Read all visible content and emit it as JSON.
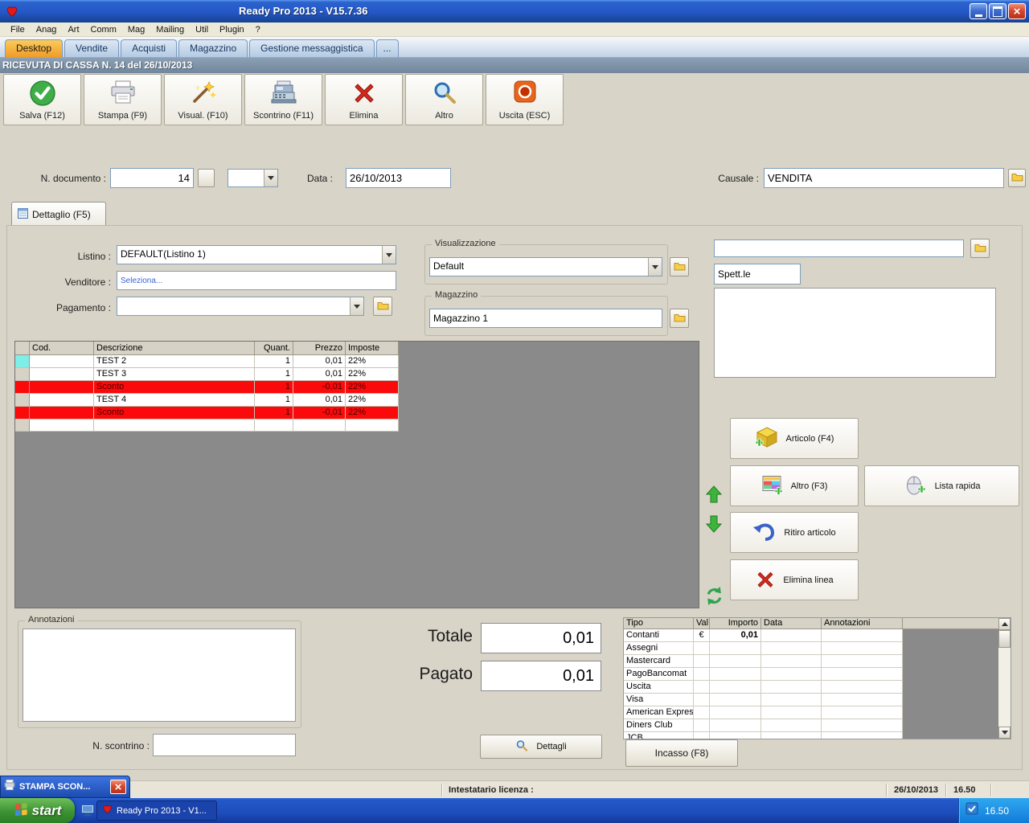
{
  "window": {
    "title": "Ready Pro 2013 - V15.7.36",
    "header_title": "RICEVUTA DI CASSA N. 14 del 26/10/2013"
  },
  "menu": {
    "items": [
      "File",
      "Anag",
      "Art",
      "Comm",
      "Mag",
      "Mailing",
      "Util",
      "Plugin",
      "?"
    ]
  },
  "tabs": {
    "items": [
      "Desktop",
      "Vendite",
      "Acquisti",
      "Magazzino",
      "Gestione messaggistica",
      "..."
    ],
    "active": "Desktop"
  },
  "toolbar": {
    "salva": "Salva (F12)",
    "stampa": "Stampa (F9)",
    "visual": "Visual. (F10)",
    "scontrino": "Scontrino (F11)",
    "elimina": "Elimina",
    "altro": "Altro",
    "uscita": "Uscita (ESC)"
  },
  "doc_fields": {
    "n_documento_label": "N. documento :",
    "n_documento": "14",
    "data_label": "Data :",
    "data": "26/10/2013",
    "causale_label": "Causale :",
    "causale": "VENDITA"
  },
  "detail_tab_label": "Dettaglio (F5)",
  "form": {
    "listino_label": "Listino :",
    "listino": "DEFAULT(Listino 1)",
    "venditore_label": "Venditore :",
    "venditore": "Seleziona...",
    "pagamento_label": "Pagamento :",
    "visualizzazione_title": "Visualizzazione",
    "visualizzazione": "Default",
    "magazzino_title": "Magazzino",
    "magazzino": "Magazzino 1",
    "spett": "Spett.le"
  },
  "items_table": {
    "headers": {
      "cod": "Cod.",
      "descrizione": "Descrizione",
      "quant": "Quant.",
      "prezzo": "Prezzo",
      "imposte": "Imposte"
    },
    "rows": [
      {
        "descrizione": "TEST 2",
        "quant": "1",
        "prezzo": "0,01",
        "imposte": "22%"
      },
      {
        "descrizione": "TEST 3",
        "quant": "1",
        "prezzo": "0,01",
        "imposte": "22%"
      },
      {
        "descrizione": "Sconto",
        "quant": "1",
        "prezzo": "-0,01",
        "imposte": "22%"
      },
      {
        "descrizione": "TEST 4",
        "quant": "1",
        "prezzo": "0,01",
        "imposte": "22%"
      },
      {
        "descrizione": "Sconto",
        "quant": "1",
        "prezzo": "-0,01",
        "imposte": "22%"
      }
    ]
  },
  "side_buttons": {
    "articolo": "Articolo (F4)",
    "altro": "Altro (F3)",
    "lista_rapida": "Lista rapida",
    "ritiro": "Ritiro articolo",
    "elimina_linea": "Elimina linea"
  },
  "bottom": {
    "annotazioni_title": "Annotazioni",
    "n_scontrino_label": "N. scontrino :",
    "totale_label": "Totale",
    "totale": "0,01",
    "pagato_label": "Pagato",
    "pagato": "0,01",
    "dettagli": "Dettagli",
    "incasso": "Incasso (F8)"
  },
  "payments": {
    "headers": {
      "tipo": "Tipo",
      "val": "Val",
      "importo": "Importo",
      "data": "Data",
      "annotazioni": "Annotazioni"
    },
    "rows": [
      {
        "tipo": "Contanti",
        "val": "€",
        "importo": "0,01"
      },
      {
        "tipo": "Assegni"
      },
      {
        "tipo": "Mastercard"
      },
      {
        "tipo": "PagoBancomat"
      },
      {
        "tipo": "Uscita"
      },
      {
        "tipo": "Visa"
      },
      {
        "tipo": "American Express"
      },
      {
        "tipo": "Diners Club"
      },
      {
        "tipo": "JCB"
      }
    ]
  },
  "status_bar": {
    "stampa_window": "STAMPA SCON...",
    "licenza": "Intestatario licenza :",
    "date": "26/10/2013",
    "time": "16.50"
  },
  "taskbar": {
    "start": "start",
    "task": "Ready Pro 2013 - V1...",
    "clock": "16.50"
  },
  "colors": {
    "active_tab": "#F2A73A",
    "discount_row": "#FA0A0A",
    "selected_marker": "#7FEEE6",
    "header_bar": "#7D90A5"
  }
}
